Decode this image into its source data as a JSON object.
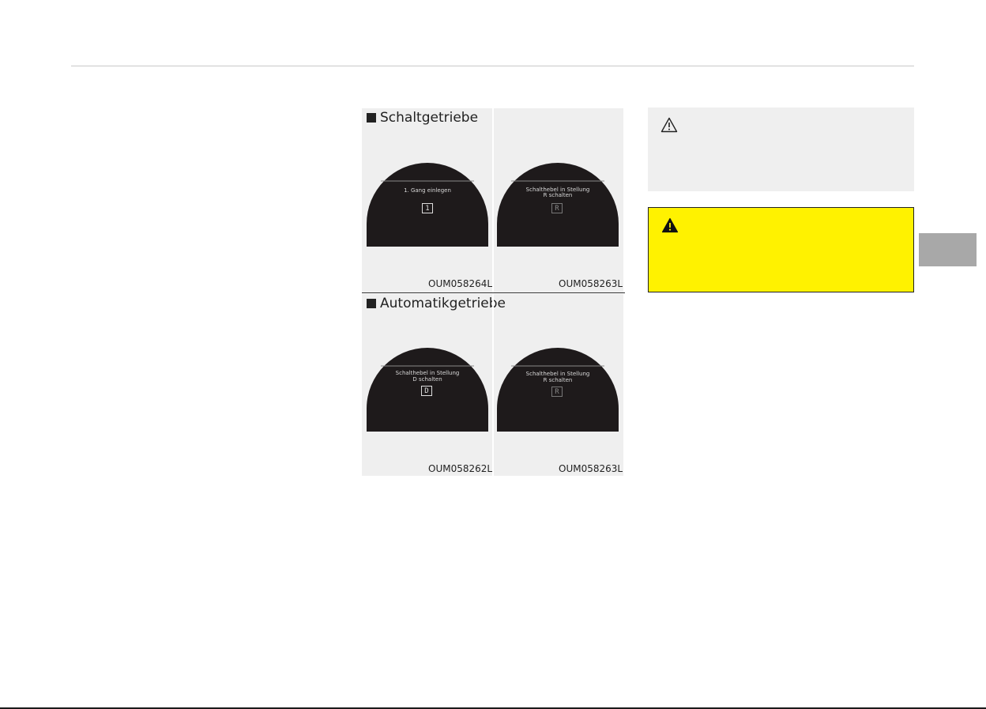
{
  "figures": {
    "manual": {
      "title": "Schaltgetriebe",
      "left": {
        "message": "1. Gang einlegen",
        "gear": "1",
        "code": "OUM058264L"
      },
      "right": {
        "message_line1": "Schalthebel in Stellung",
        "message_line2": "R schalten",
        "gear": "R",
        "code": "OUM058263L"
      }
    },
    "automatic": {
      "title": "Automatikgetriebe",
      "left": {
        "message_line1": "Schalthebel in Stellung",
        "message_line2": "D schalten",
        "gear": "D",
        "code": "OUM058262L"
      },
      "right": {
        "message_line1": "Schalthebel in Stellung",
        "message_line2": "R schalten",
        "gear": "R",
        "code": "OUM058263L"
      }
    }
  },
  "icons": {
    "caution": "caution-triangle-icon",
    "warning": "warning-triangle-icon",
    "bullet": "square-bullet-icon"
  },
  "colors": {
    "warning_background": "#fff200",
    "caution_background": "#efefef",
    "chapter_tab": "#a8a8a8",
    "display": "#1e1a1b"
  }
}
